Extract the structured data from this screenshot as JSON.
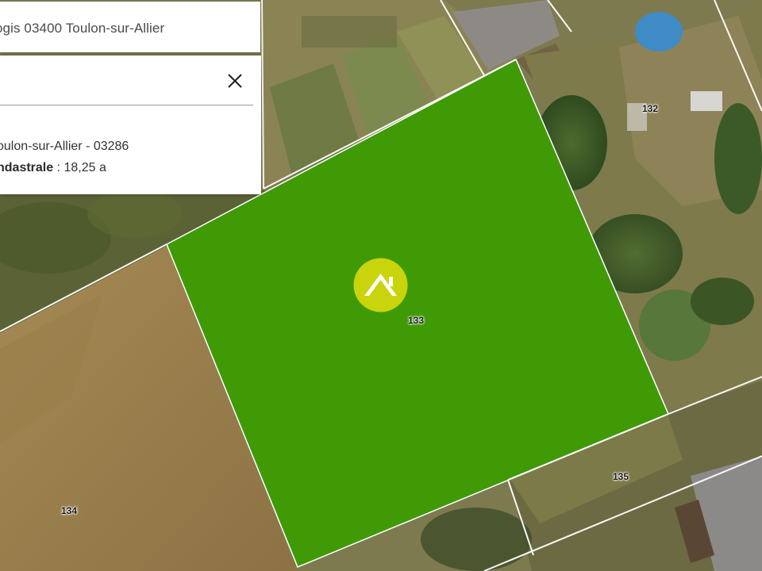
{
  "search": {
    "address": "ogis 03400 Toulon-sur-Allier"
  },
  "info_panel": {
    "commune_line": "oulon-sur-Allier - 03286",
    "area_label": "ndastrale",
    "area_separator": " : ",
    "area_value": "18,25 a"
  },
  "parcels": {
    "selected": "133",
    "north_east": "132",
    "west": "134",
    "south_east": "135"
  },
  "colors": {
    "selected_parcel": "#3f9a06",
    "parcel_border": "#ffffff",
    "marker": "#c9d40c",
    "panel_background": "#ffffff"
  },
  "icons": {
    "marker": "home-marker-icon",
    "close": "close-icon"
  }
}
